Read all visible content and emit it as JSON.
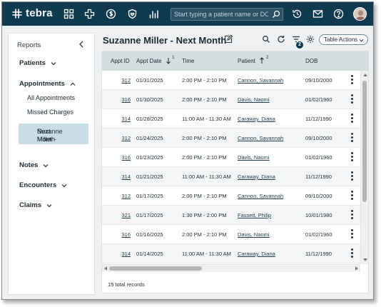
{
  "colors": {
    "topbar": "#0f3a4f",
    "header_row": "#d5dde1",
    "active_nav": "#c9dde6",
    "page_background": "#eef0f1"
  },
  "app": {
    "logo_text": "tebra",
    "search_placeholder": "Start typing a patient name or DOB"
  },
  "topnav_icons": [
    "grid-icon",
    "plus-cross-icon",
    "dollar-icon",
    "shield-heart-icon",
    "bar-chart-icon",
    "history-icon",
    "mail-icon",
    "help-icon",
    "user-avatar"
  ],
  "sidebar": {
    "title": "Reports",
    "groups": {
      "patients": "Patients",
      "appointments": "Appointments",
      "notes": "Notes",
      "encounters": "Encounters",
      "claims": "Claims"
    },
    "appointment_items": {
      "all": "All Appointments",
      "missed": "Missed Charges",
      "active_line1": "Suzanne Miller -",
      "active_line2": "Next Month"
    }
  },
  "page": {
    "title": "Suzanne Miller - Next Month",
    "filter_count": "2",
    "table_actions": "Table Actions",
    "total_records": "15 total records"
  },
  "table": {
    "columns": {
      "appt_id": "Appt ID",
      "appt_date": "Appt Date",
      "appt_date_sort": "1",
      "time": "Time",
      "patient": "Patient",
      "patient_sort": "2",
      "dob": "DOB"
    },
    "rows": [
      {
        "id": "312",
        "date": "01/31/2025",
        "time": "2:00 PM - 2:10 PM",
        "patient": "Cannon, Savannah",
        "dob": "09/10/2000"
      },
      {
        "id": "316",
        "date": "01/30/2025",
        "time": "2:00 PM - 2:10 PM",
        "patient": "Davis, Naomi",
        "dob": "01/02/1960"
      },
      {
        "id": "314",
        "date": "01/28/2025",
        "time": "11:00 AM - 11:30 AM",
        "patient": "Caraway, Diana",
        "dob": "11/12/1990"
      },
      {
        "id": "312",
        "date": "01/24/2025",
        "time": "2:00 PM - 2:10 PM",
        "patient": "Cannon, Savannah",
        "dob": "09/10/2000"
      },
      {
        "id": "316",
        "date": "01/23/2025",
        "time": "2:00 PM - 2:10 PM",
        "patient": "Davis, Naomi",
        "dob": "01/02/1960"
      },
      {
        "id": "314",
        "date": "01/21/2025",
        "time": "11:00 AM - 11:30 AM",
        "patient": "Caraway, Diana",
        "dob": "11/12/1990"
      },
      {
        "id": "312",
        "date": "01/17/2025",
        "time": "2:00 PM - 2:10 PM",
        "patient": "Cannon, Savannah",
        "dob": "09/10/2000"
      },
      {
        "id": "321",
        "date": "01/17/2025",
        "time": "1:30 PM - 2:00 PM",
        "patient": "Fassett, Philip",
        "dob": "10/01/1980"
      },
      {
        "id": "316",
        "date": "01/16/2025",
        "time": "2:00 PM - 2:10 PM",
        "patient": "Davis, Naomi",
        "dob": "01/02/1960"
      },
      {
        "id": "314",
        "date": "01/14/2025",
        "time": "11:00 AM - 11:30 AM",
        "patient": "Caraway, Diana",
        "dob": "11/12/1990"
      }
    ]
  }
}
